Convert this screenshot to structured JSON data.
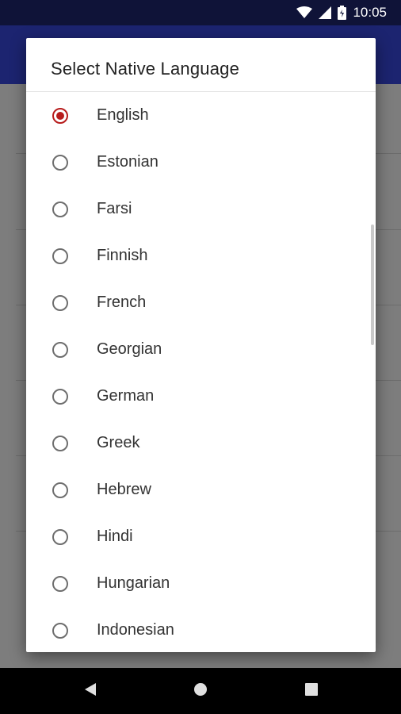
{
  "status_bar": {
    "time": "10:05",
    "icons": [
      "wifi-icon",
      "cell-signal-icon",
      "battery-icon"
    ]
  },
  "dialog": {
    "title": "Select Native Language",
    "selected": "English",
    "options": [
      {
        "label": "English",
        "checked": true
      },
      {
        "label": "Estonian",
        "checked": false
      },
      {
        "label": "Farsi",
        "checked": false
      },
      {
        "label": "Finnish",
        "checked": false
      },
      {
        "label": "French",
        "checked": false
      },
      {
        "label": "Georgian",
        "checked": false
      },
      {
        "label": "German",
        "checked": false
      },
      {
        "label": "Greek",
        "checked": false
      },
      {
        "label": "Hebrew",
        "checked": false
      },
      {
        "label": "Hindi",
        "checked": false
      },
      {
        "label": "Hungarian",
        "checked": false
      },
      {
        "label": "Indonesian",
        "checked": false
      }
    ]
  },
  "nav_bar": {
    "icons": [
      "back-icon",
      "home-icon",
      "recents-icon"
    ]
  },
  "colors": {
    "accent": "#b71c1c",
    "app_bar": "#1c2470",
    "status_bar": "#0f1338"
  }
}
